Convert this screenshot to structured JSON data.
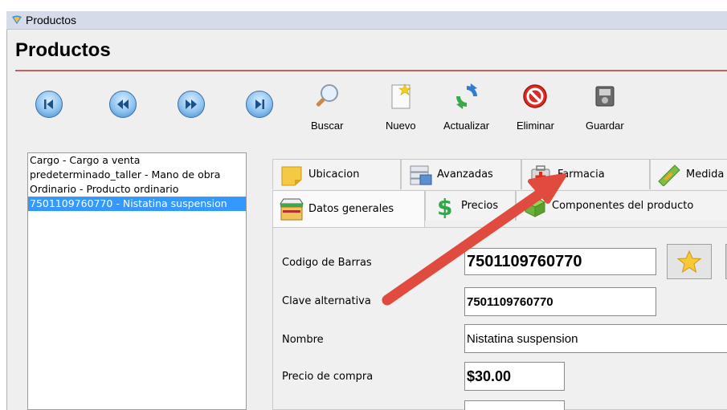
{
  "window": {
    "title": "Productos"
  },
  "heading": "Productos",
  "toolbar": {
    "buscar": "Buscar",
    "nuevo": "Nuevo",
    "actualizar": "Actualizar",
    "eliminar": "Eliminar",
    "guardar": "Guardar"
  },
  "nav_icons": [
    "first-icon",
    "previous-icon",
    "next-icon",
    "last-icon"
  ],
  "list": {
    "items": [
      {
        "label": "Cargo - Cargo a venta"
      },
      {
        "label": "predeterminado_taller - Mano de obra"
      },
      {
        "label": "Ordinario - Producto ordinario"
      },
      {
        "label": "7501109760770 - Nistatina suspension"
      }
    ],
    "selected_index": 3
  },
  "tabs_row1": [
    {
      "label": "Ubicacion",
      "icon": "note-icon"
    },
    {
      "label": "Avanzadas",
      "icon": "database-icon"
    },
    {
      "label": "Farmacia",
      "icon": "first-aid-icon"
    },
    {
      "label": "Medida",
      "icon": "ruler-icon"
    }
  ],
  "tabs_row2": [
    {
      "label": "Datos generales",
      "icon": "store-icon"
    },
    {
      "label": "Precios",
      "icon": "dollar-icon"
    },
    {
      "label": "Componentes del producto",
      "icon": "boxes-icon"
    }
  ],
  "form": {
    "barcode_label": "Codigo de Barras",
    "barcode_value": "7501109760770",
    "alt_key_label": "Clave alternativa",
    "alt_key_value": "7501109760770",
    "name_label": "Nombre",
    "name_value": "Nistatina suspension",
    "purchase_price_label": "Precio de compra",
    "purchase_price_value": "$30.00"
  },
  "colors": {
    "selection": "#3399ff",
    "arrow": "#e04a3f",
    "heading_rule": "#c06060"
  }
}
